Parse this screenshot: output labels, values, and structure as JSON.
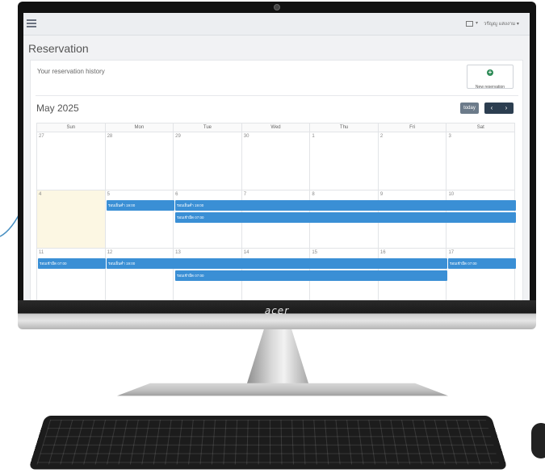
{
  "header": {
    "user_name": "วรัญญู แสงงาม ▾"
  },
  "page": {
    "title": "Reservation"
  },
  "panel": {
    "history_label": "Your reservation history",
    "new_button_label": "New reservation"
  },
  "calendar": {
    "month_label": "May 2025",
    "today_label": "today",
    "prev_label": "‹",
    "next_label": "›",
    "weekdays": [
      "Sun",
      "Mon",
      "Tue",
      "Wed",
      "Thu",
      "Fri",
      "Sat"
    ],
    "weeks": [
      [
        "27",
        "28",
        "29",
        "30",
        "1",
        "2",
        "3"
      ],
      [
        "4",
        "5",
        "6",
        "7",
        "8",
        "9",
        "10"
      ],
      [
        "11",
        "12",
        "13",
        "14",
        "15",
        "16",
        "17"
      ]
    ],
    "today_date": "4",
    "events": {
      "evening": "รอบเย็นค่ำ 19:00",
      "morning": "รอบเช้ามืด 07:00"
    }
  },
  "device": {
    "brand": "acer"
  },
  "icons": [
    "menu-icon",
    "mail-icon",
    "plus-circle-icon"
  ],
  "colors": {
    "event": "#3a8fd5",
    "today_bg": "#fcf7e3",
    "nav": "#2c3e50",
    "add": "#2e8b57"
  }
}
